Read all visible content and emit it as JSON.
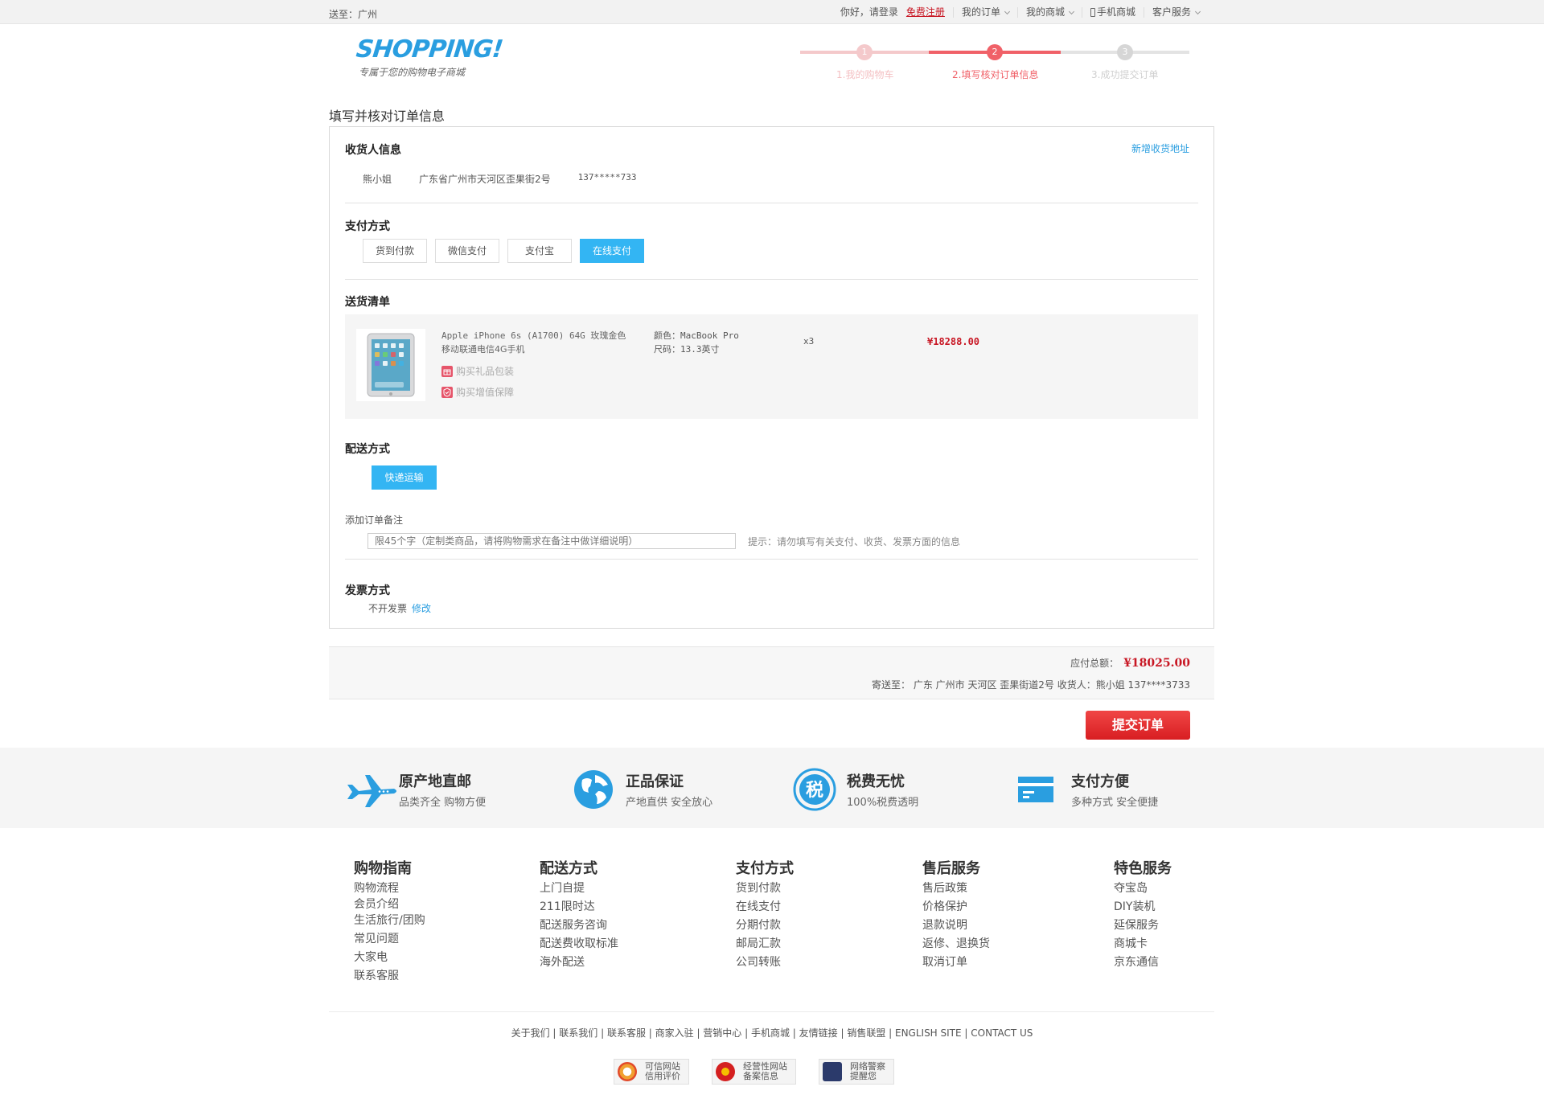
{
  "topbar": {
    "location": "送至：广州",
    "greeting": "你好，请登录",
    "register": "免费注册",
    "my_orders": "我的订单",
    "my_mall": "我的商城",
    "mobile_mall": "手机商城",
    "customer_service": "客户服务"
  },
  "logo": {
    "word": "SHOPPING!",
    "tagline": "专属于您的购物电子商城"
  },
  "steps": [
    {
      "num": "1",
      "label": "1.我的购物车"
    },
    {
      "num": "2",
      "label": "2.填写核对订单信息"
    },
    {
      "num": "3",
      "label": "3.成功提交订单"
    }
  ],
  "page_title": "填写并核对订单信息",
  "receiver": {
    "title": "收货人信息",
    "add_address": "新增收货地址",
    "name": "熊小姐",
    "address": "广东省广州市天河区歪果街2号",
    "phone": "137*****733"
  },
  "payment": {
    "title": "支付方式",
    "options": [
      "货到付款",
      "微信支付",
      "支付宝",
      "在线支付"
    ],
    "selected": "在线支付"
  },
  "goods": {
    "title": "送货清单",
    "name_line1": "Apple iPhone 6s (A1700) 64G 玫瑰金色",
    "name_line2": "移动联通电信4G手机",
    "gift": "购买礼品包装",
    "warranty": "购买增值保障",
    "color": "颜色：MacBook Pro",
    "size": "尺码：13.3英寸",
    "qty": "x3",
    "price": "¥18288.00"
  },
  "shipping": {
    "title": "配送方式",
    "option": "快递运输"
  },
  "memo": {
    "label": "添加订单备注",
    "placeholder": "限45个字（定制类商品，请将购物需求在备注中做详细说明）",
    "tip": "提示：请勿填写有关支付、收货、发票方面的信息"
  },
  "invoice": {
    "title": "发票方式",
    "value": "不开发票",
    "modify": "修改"
  },
  "summary": {
    "total_label": "应付总额：",
    "total": "¥18025.00",
    "ship_to": "寄送至： 广东 广州市 天河区 歪果街道2号 收货人：熊小姐 137****3733"
  },
  "submit": "提交订单",
  "services": [
    {
      "icon": "airplane-icon",
      "title": "原产地直邮",
      "sub": "品类齐全 购物方便"
    },
    {
      "icon": "globe-icon",
      "title": "正品保证",
      "sub": "产地直供 安全放心"
    },
    {
      "icon": "tax-icon",
      "title": "税费无忧",
      "sub": "100%税费透明"
    },
    {
      "icon": "card-icon",
      "title": "支付方便",
      "sub": "多种方式 安全便捷"
    }
  ],
  "footer_cols": [
    {
      "title": "购物指南",
      "links": [
        "购物流程",
        "会员介绍",
        "生活旅行/团购",
        "常见问题",
        "大家电",
        "联系客服"
      ]
    },
    {
      "title": "配送方式",
      "links": [
        "上门自提",
        "211限时达",
        "配送服务咨询",
        "配送费收取标准",
        "海外配送"
      ]
    },
    {
      "title": "支付方式",
      "links": [
        "货到付款",
        "在线支付",
        "分期付款",
        "邮局汇款",
        "公司转账"
      ]
    },
    {
      "title": "售后服务",
      "links": [
        "售后政策",
        "价格保护",
        "退款说明",
        "返修、退换货",
        "取消订单"
      ]
    },
    {
      "title": "特色服务",
      "links": [
        "夺宝岛",
        "DIY装机",
        "延保服务",
        "商城卡",
        "京东通信"
      ]
    }
  ],
  "footer_links": "关于我们 | 联系我们 | 联系客服 | 商家入驻 | 营销中心 | 手机商城 | 友情链接 | 销售联盟 | ENGLISH SITE | CONTACT US",
  "badges": [
    {
      "line1": "可信网站",
      "line2": "信用评价"
    },
    {
      "line1": "经营性网站",
      "line2": "备案信息"
    },
    {
      "line1": "网络警察",
      "line2": "提醒您"
    }
  ],
  "colors": {
    "accent_blue": "#33b5f3",
    "brand_blue": "#2a9ee0",
    "price_red": "#c81623",
    "step_active": "#f06168"
  }
}
